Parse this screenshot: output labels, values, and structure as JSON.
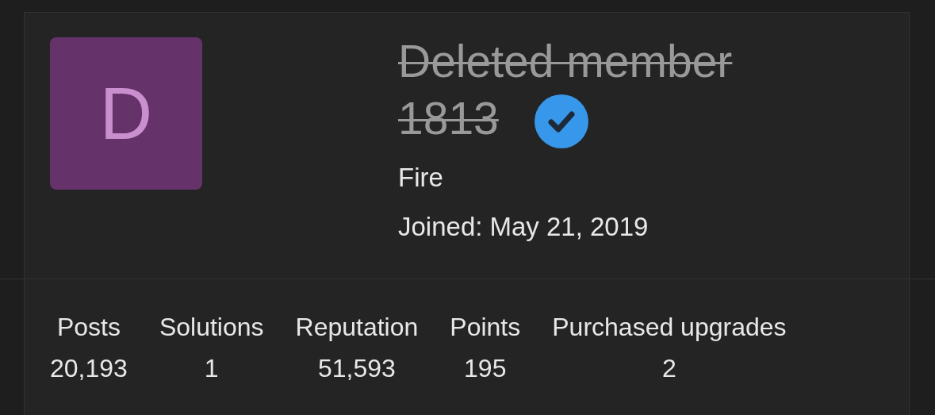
{
  "profile": {
    "avatar_letter": "D",
    "name": "Deleted member 1813",
    "deleted": true,
    "verified": true,
    "title": "Fire",
    "joined_label": "Joined:",
    "joined_date": "May 21, 2019"
  },
  "stats": [
    {
      "label": "Posts",
      "value": "20,193"
    },
    {
      "label": "Solutions",
      "value": "1"
    },
    {
      "label": "Reputation",
      "value": "51,593"
    },
    {
      "label": "Points",
      "value": "195"
    },
    {
      "label": "Purchased upgrades",
      "value": "2"
    }
  ]
}
